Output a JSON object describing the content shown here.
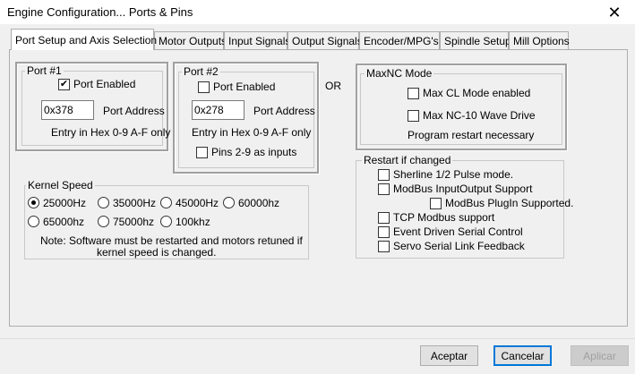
{
  "window": {
    "title": "Engine Configuration... Ports & Pins"
  },
  "tabs": [
    {
      "label": "Port Setup and Axis Selection"
    },
    {
      "label": "Motor Outputs"
    },
    {
      "label": "Input Signals"
    },
    {
      "label": "Output Signals"
    },
    {
      "label": "Encoder/MPG's"
    },
    {
      "label": "Spindle Setup"
    },
    {
      "label": "Mill Options"
    }
  ],
  "port1": {
    "title": "Port #1",
    "enabled_label": "Port Enabled",
    "enabled": true,
    "address": "0x378",
    "address_label": "Port Address",
    "hint": "Entry in Hex 0-9 A-F only"
  },
  "port2": {
    "title": "Port #2",
    "enabled_label": "Port Enabled",
    "enabled": false,
    "address": "0x278",
    "address_label": "Port Address",
    "hint": "Entry in Hex 0-9 A-F only",
    "pins_label": "Pins 2-9 as inputs",
    "pins_checked": false
  },
  "or_label": "OR",
  "maxnc": {
    "title": "MaxNC Mode",
    "cl_label": "Max CL Mode enabled",
    "nc10_label": "Max NC-10 Wave Drive",
    "note": "Program restart necessary"
  },
  "kernel": {
    "title": "Kernel Speed",
    "options": [
      "25000Hz",
      "35000Hz",
      "45000Hz",
      "60000hz",
      "65000hz",
      "75000hz",
      "100khz"
    ],
    "selected": "25000Hz",
    "note_line1": "Note: Software must be restarted and motors retuned if",
    "note_line2": "kernel speed is changed."
  },
  "restart": {
    "title": "Restart if changed",
    "items": [
      {
        "label": "Sherline 1/2 Pulse mode."
      },
      {
        "label": "ModBus InputOutput Support"
      },
      {
        "label": "ModBus PlugIn Supported."
      },
      {
        "label": "TCP Modbus support"
      },
      {
        "label": "Event Driven Serial Control"
      },
      {
        "label": "Servo Serial Link Feedback"
      }
    ]
  },
  "buttons": {
    "accept": "Aceptar",
    "cancel": "Cancelar",
    "apply": "Aplicar"
  },
  "icons": {
    "close": "close-icon",
    "check": "checkmark-icon"
  }
}
